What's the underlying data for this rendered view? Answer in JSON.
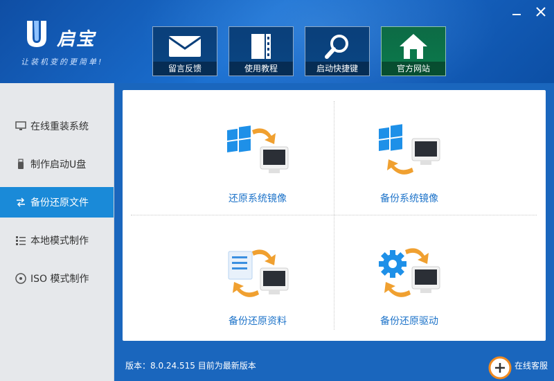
{
  "app": {
    "logo_text": "启宝",
    "slogan": "让装机变的更简单!"
  },
  "toolbar": {
    "tiles": [
      {
        "label": "留言反馈",
        "icon": "envelope-icon"
      },
      {
        "label": "使用教程",
        "icon": "book-icon"
      },
      {
        "label": "启动快捷键",
        "icon": "magnifier-icon"
      },
      {
        "label": "官方网站",
        "icon": "home-icon"
      }
    ]
  },
  "sidebar": {
    "items": [
      {
        "label": "在线重装系统",
        "icon": "monitor-icon",
        "active": false
      },
      {
        "label": "制作启动U盘",
        "icon": "usb-icon",
        "active": false
      },
      {
        "label": "备份还原文件",
        "icon": "backup-icon",
        "active": true
      },
      {
        "label": "本地模式制作",
        "icon": "list-icon",
        "active": false
      },
      {
        "label": "ISO 模式制作",
        "icon": "disc-icon",
        "active": false
      }
    ]
  },
  "main": {
    "actions": [
      {
        "label": "还原系统镜像",
        "icon": "windows-to-pc-icon"
      },
      {
        "label": "备份系统镜像",
        "icon": "pc-to-windows-icon"
      },
      {
        "label": "备份还原资料",
        "icon": "documents-sync-icon"
      },
      {
        "label": "备份还原驱动",
        "icon": "gear-sync-icon"
      }
    ]
  },
  "footer": {
    "version_text": "版本：8.0.24.515 目前为最新版本",
    "service_label": "在线客服"
  },
  "colors": {
    "header_blue": "#1565b8",
    "active_nav": "#1a8ad8",
    "accent_text": "#1d73c9",
    "arrow_orange": "#f0a030",
    "tile_green": "#0b7a4c"
  }
}
